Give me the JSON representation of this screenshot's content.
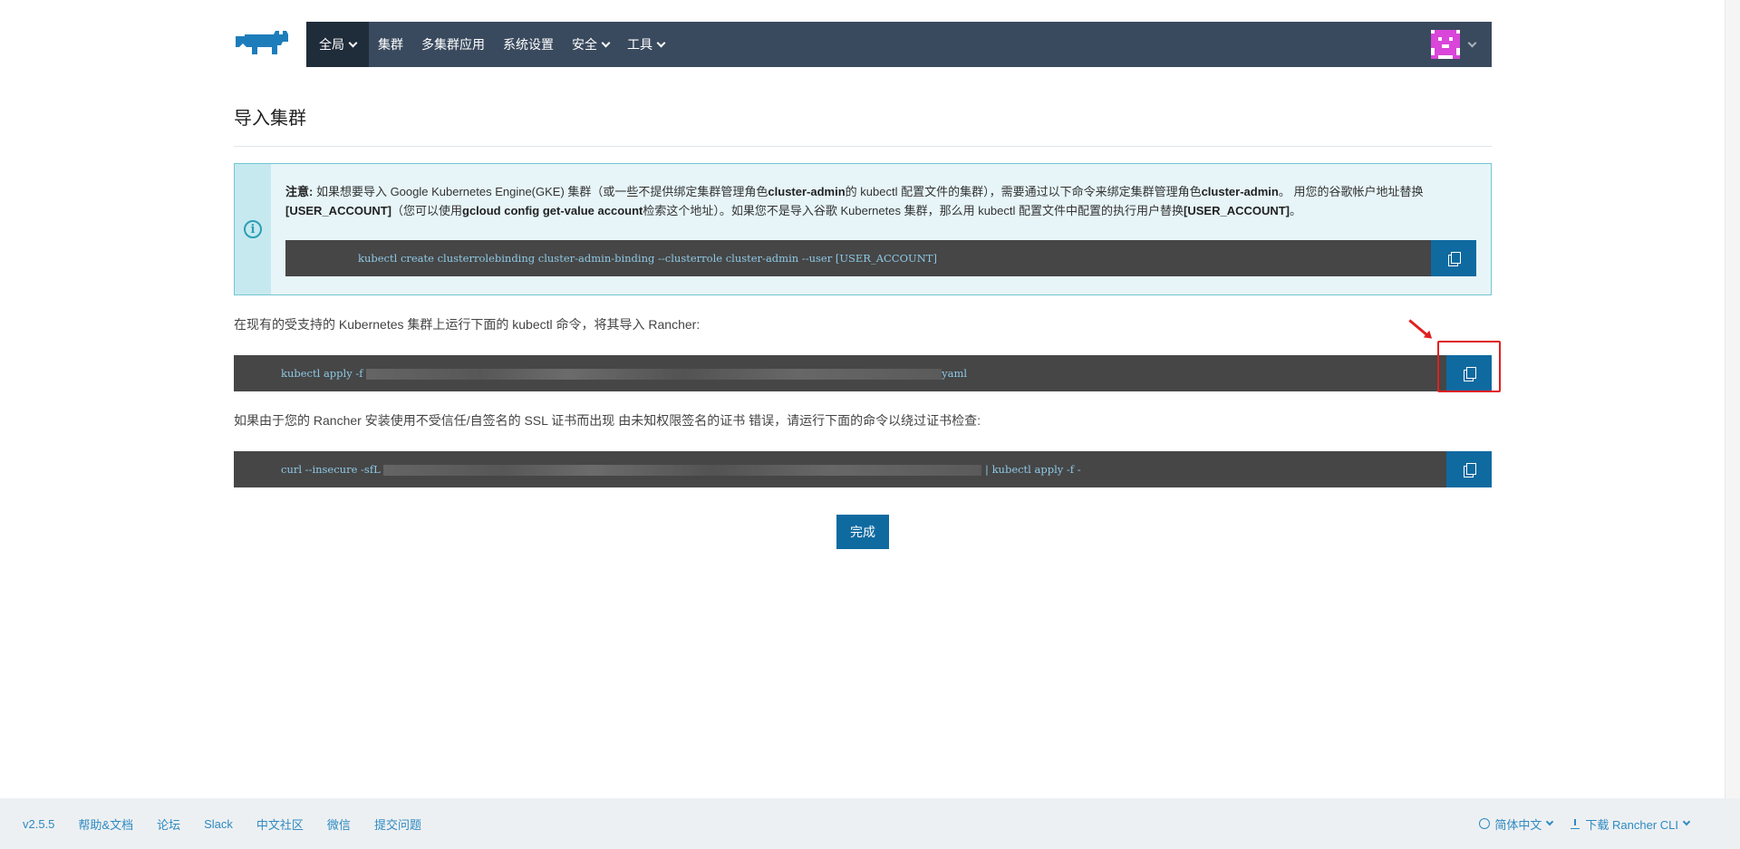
{
  "nav": {
    "items": [
      {
        "label": "全局",
        "dropdown": true,
        "active": true
      },
      {
        "label": "集群",
        "dropdown": false
      },
      {
        "label": "多集群应用",
        "dropdown": false
      },
      {
        "label": "系统设置",
        "dropdown": false
      },
      {
        "label": "安全",
        "dropdown": true
      },
      {
        "label": "工具",
        "dropdown": true
      }
    ]
  },
  "page": {
    "title": "导入集群"
  },
  "banner": {
    "note_label": "注意:",
    "text_1": " 如果想要导入 Google Kubernetes Engine(GKE) 集群（或一些不提供绑定集群管理角色",
    "bold_1": "cluster-admin",
    "text_2": "的 kubectl 配置文件的集群），需要通过以下命令来绑定集群管理角色",
    "bold_2": "cluster-admin",
    "text_3": "。 用您的谷歌帐户地址替换 ",
    "bold_3": "[USER_ACCOUNT]",
    "text_4": "（您可以使用",
    "bold_4": "gcloud config get-value account",
    "text_5": "检索这个地址）。如果您不是导入谷歌 Kubernetes 集群，那么用 kubectl 配置文件中配置的执行用户替换",
    "bold_5": "[USER_ACCOUNT]",
    "text_6": "。",
    "command": "kubectl create clusterrolebinding cluster-admin-binding --clusterrole cluster-admin --user [USER_ACCOUNT]"
  },
  "import": {
    "instruction": "在现有的受支持的 Kubernetes 集群上运行下面的 kubectl 命令，将其导入 Rancher:",
    "command_prefix": "kubectl apply -f ",
    "command_suffix": "yaml"
  },
  "insecure": {
    "instruction": "如果由于您的 Rancher 安装使用不受信任/自签名的 SSL 证书而出现 由未知权限签名的证书 错误，请运行下面的命令以绕过证书检查:",
    "command_prefix": "curl --insecure -sfL ",
    "command_suffix": " | kubectl apply -f -"
  },
  "actions": {
    "done": "完成"
  },
  "footer": {
    "version": "v2.5.5",
    "links": [
      "帮助&文档",
      "论坛",
      "Slack",
      "中文社区",
      "微信",
      "提交问题"
    ],
    "language": "简体中文",
    "download": "下载 Rancher CLI"
  },
  "colors": {
    "nav_bg": "#3a4a5e",
    "primary": "#0f6aa0",
    "highlight": "#e02020"
  }
}
